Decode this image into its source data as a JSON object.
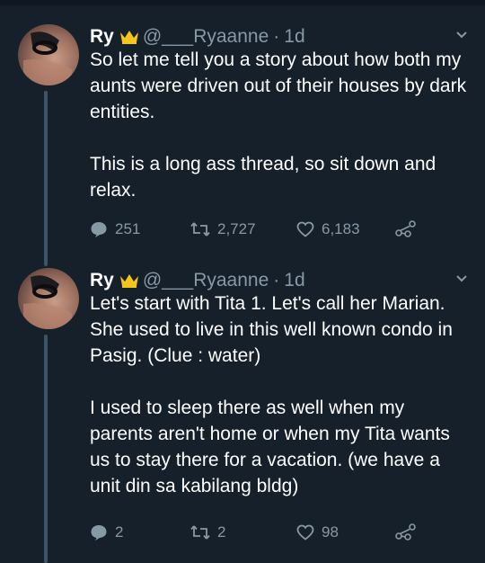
{
  "tweets": [
    {
      "name": "Ry",
      "handle": "@___Ryaanne",
      "separator": "·",
      "time": "1d",
      "paragraphs": [
        "So let me tell you a story about how both my aunts were driven out of their houses by dark entities.",
        "This is a long ass thread, so sit down and relax."
      ],
      "replies": "251",
      "retweets": "2,727",
      "likes": "6,183"
    },
    {
      "name": "Ry",
      "handle": "@___Ryaanne",
      "separator": "·",
      "time": "1d",
      "paragraphs": [
        "Let's start with Tita 1. Let's call her Marian. She used to live in this well known condo in Pasig. (Clue : water)",
        "I used to sleep there as well when my parents aren't home or when my Tita wants us to stay there for a vacation. (we have a unit din sa kabilang bldg)"
      ],
      "replies": "2",
      "retweets": "2",
      "likes": "98"
    }
  ],
  "icons": {
    "crown": "crown-icon",
    "chevron": "chevron-down-icon",
    "reply": "reply-icon",
    "retweet": "retweet-icon",
    "like": "heart-icon",
    "share": "share-icon"
  },
  "colors": {
    "background": "#15202b",
    "text": "#ffffff",
    "secondary": "#8899a6",
    "thread_line": "#3d5466",
    "crown": "#f5c518"
  }
}
